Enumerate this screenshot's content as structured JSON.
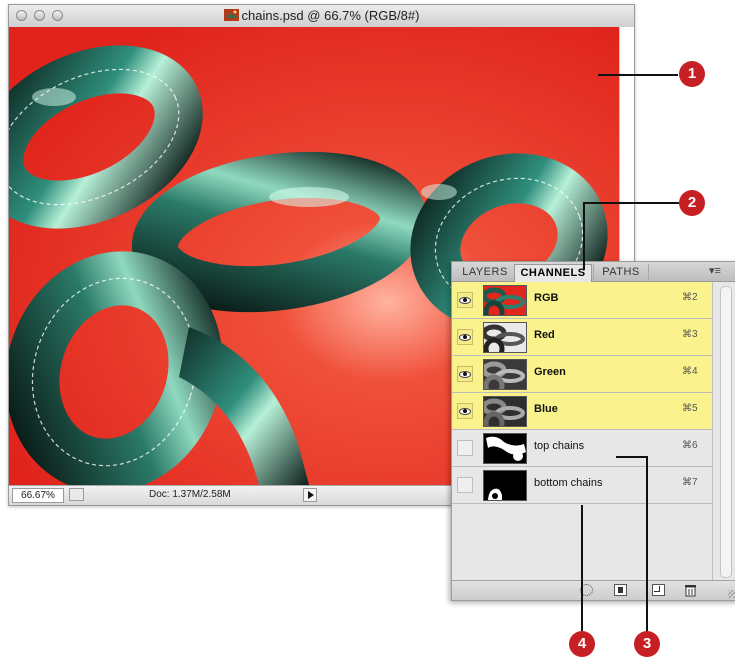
{
  "window": {
    "title": "chains.psd @ 66.7% (RGB/8#)",
    "zoom": "66.67%",
    "doc_info": "Doc: 1.37M/2.58M"
  },
  "panel": {
    "tabs": [
      "LAYERS",
      "CHANNELS",
      "PATHS"
    ],
    "active_tab": "CHANNELS",
    "channels": [
      {
        "name": "RGB",
        "shortcut": "⌘2",
        "visible": true,
        "selected": true
      },
      {
        "name": "Red",
        "shortcut": "⌘3",
        "visible": true,
        "selected": true
      },
      {
        "name": "Green",
        "shortcut": "⌘4",
        "visible": true,
        "selected": true
      },
      {
        "name": "Blue",
        "shortcut": "⌘5",
        "visible": true,
        "selected": true
      },
      {
        "name": "top chains",
        "shortcut": "⌘6",
        "visible": false,
        "selected": false
      },
      {
        "name": "bottom chains",
        "shortcut": "⌘7",
        "visible": false,
        "selected": false
      }
    ]
  },
  "callouts": [
    "1",
    "2",
    "3",
    "4"
  ],
  "colors": {
    "callout": "#c62024",
    "canvas": "#e8251c",
    "selected_row": "#faf28c"
  }
}
